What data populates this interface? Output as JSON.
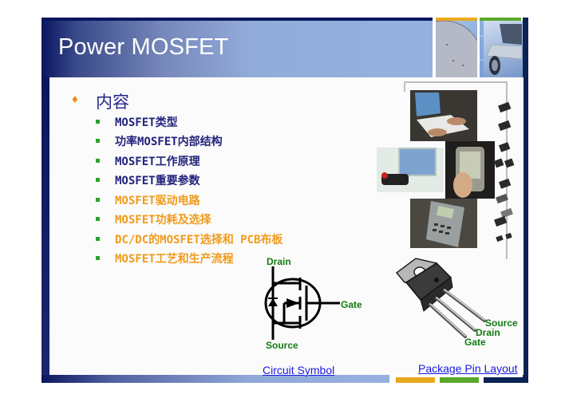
{
  "slide": {
    "title": "Power MOSFET",
    "section_heading": "内容",
    "items": [
      {
        "label": "MOSFET类型",
        "color": "#22227e"
      },
      {
        "label": "功率MOSFET内部结构",
        "color": "#22227e"
      },
      {
        "label": "MOSFET工作原理",
        "color": "#22227e"
      },
      {
        "label": "MOSFET重要参数",
        "color": "#22227e"
      },
      {
        "label": "MOSFET驱动电路",
        "color": "#f09a1a"
      },
      {
        "label": "MOSFET功耗及选择",
        "color": "#f09a1a"
      },
      {
        "label": "DC/DC的MOSFET选择和 PCB布板",
        "color": "#f09a1a"
      },
      {
        "label": "MOSFET工艺和生产流程",
        "color": "#f09a1a"
      }
    ]
  },
  "circuit_symbol": {
    "drain_label": "Drain",
    "gate_label": "Gate",
    "source_label": "Source",
    "link_text": "Circuit Symbol"
  },
  "package": {
    "source_label": "Source",
    "drain_label": "Drain",
    "gate_label": "Gate",
    "link_text": "Package Pin Layout"
  },
  "icons": {
    "heading_bullet": "diamond-bullet",
    "item_bullet": "square-bullet"
  },
  "theme": {
    "title_navy": "#0a1660",
    "title_light_blue": "#95b0df",
    "accent_orange": "#e9a91e",
    "accent_green": "#5aa82a",
    "frame_navy": "#0b2255",
    "pin_label_green": "#137a13",
    "link_blue": "#1a1ae0"
  }
}
